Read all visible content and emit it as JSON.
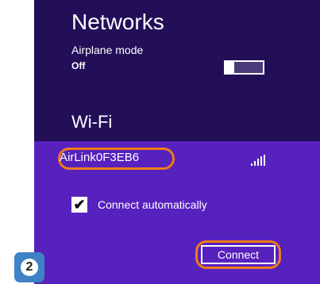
{
  "panel": {
    "title": "Networks",
    "airplane_mode": {
      "label": "Airplane mode",
      "value": "Off",
      "enabled": false
    },
    "wifi_heading": "Wi-Fi"
  },
  "network": {
    "ssid": "AirLink0F3EB6",
    "signal_icon": "signal-strength-icon",
    "connect_automatically": {
      "label": "Connect automatically",
      "checked": true
    },
    "connect_label": "Connect"
  },
  "annotation": {
    "step_number": "2",
    "highlight_color": "#f07b1b",
    "badge_color": "#3f82c6"
  },
  "colors": {
    "panel_bg": "#230e58",
    "selected_network_bg": "#5721be",
    "text": "#ffffff"
  }
}
